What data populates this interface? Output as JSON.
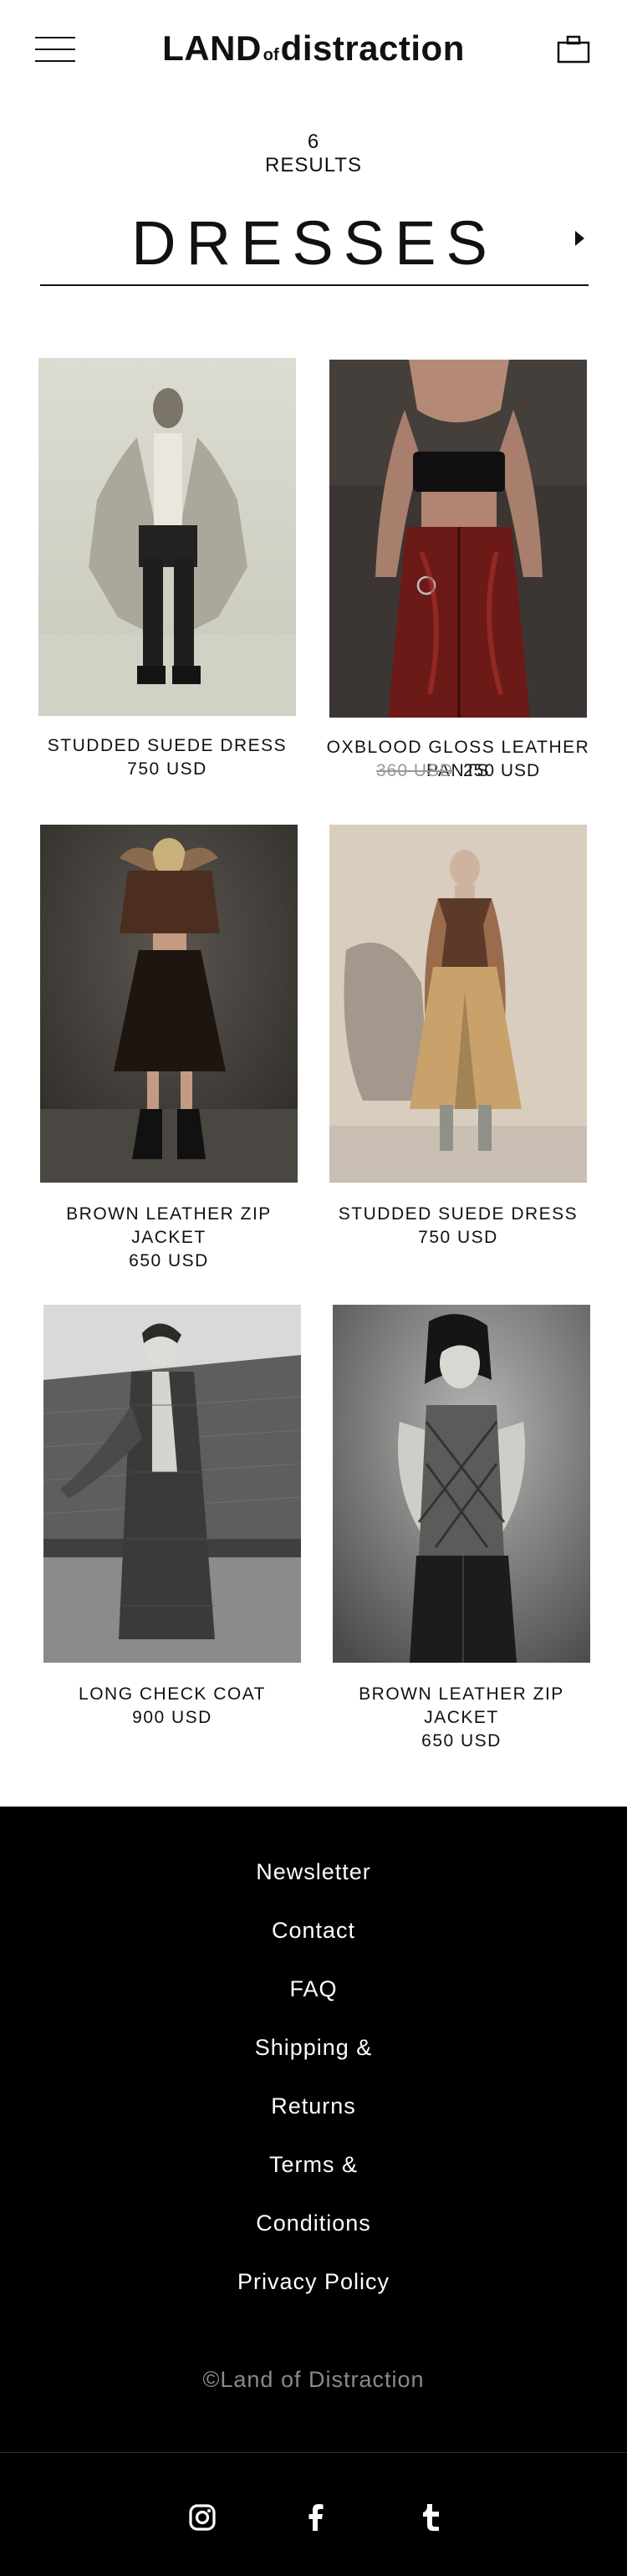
{
  "header": {
    "logo_main": "LAND",
    "logo_small": "of",
    "logo_tail": "distraction",
    "menu_icon": "hamburger-menu-icon",
    "bag_icon": "shopping-bag-icon"
  },
  "listing": {
    "results_count": "6",
    "results_label": "RESULTS",
    "category_title": "DRESSES",
    "next_icon": "caret-right-icon"
  },
  "products": [
    {
      "name": "STUDDED SUEDE DRESS",
      "price": "750 USD"
    },
    {
      "name": "OXBLOOD GLOSS LEATHER PANTS",
      "old_price": "360 USD",
      "price": "250 USD"
    },
    {
      "name_line1": "BROWN LEATHER ZIP",
      "name_line2": "JACKET",
      "price": "650 USD"
    },
    {
      "name": "STUDDED SUEDE DRESS",
      "price": "750 USD"
    },
    {
      "name": "LONG CHECK COAT",
      "price": "900 USD"
    },
    {
      "name_line1": "BROWN LEATHER ZIP",
      "name_line2": "JACKET",
      "price": "650 USD"
    }
  ],
  "footer": {
    "links": [
      "Newsletter",
      "Contact",
      "FAQ",
      "Shipping &",
      "Returns",
      "Terms &",
      "Conditions",
      "Privacy Policy"
    ],
    "copyright": "©Land of Distraction",
    "social_icons": [
      "instagram-icon",
      "facebook-icon",
      "tumblr-icon"
    ]
  },
  "colors": {
    "text": "#111111",
    "footer_bg": "#000000",
    "footer_text": "#ffffff",
    "muted": "#8a8a8a",
    "strikethrough": "#999999"
  }
}
